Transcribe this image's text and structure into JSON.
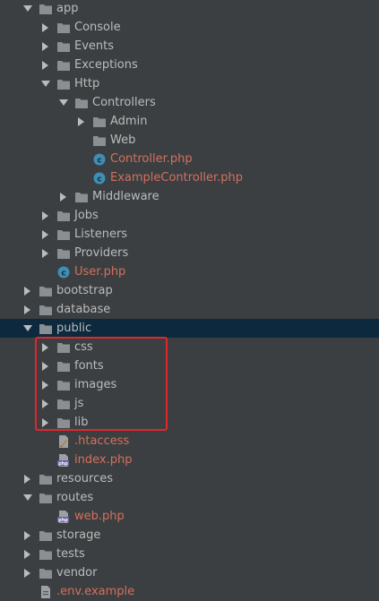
{
  "colors": {
    "background": "#3c3f41",
    "text": "#bbbbbb",
    "php_file_text": "#d2705e",
    "folder": "#8a8f93",
    "class_icon": "#3d8fb5",
    "selected_row": "#0d293e",
    "highlight_box": "#e2262a"
  },
  "tree": [
    {
      "label": "app",
      "depth": 1,
      "type": "folder",
      "expanded": true
    },
    {
      "label": "Console",
      "depth": 2,
      "type": "folder",
      "expanded": false
    },
    {
      "label": "Events",
      "depth": 2,
      "type": "folder",
      "expanded": false
    },
    {
      "label": "Exceptions",
      "depth": 2,
      "type": "folder",
      "expanded": false
    },
    {
      "label": "Http",
      "depth": 2,
      "type": "folder",
      "expanded": true
    },
    {
      "label": "Controllers",
      "depth": 3,
      "type": "folder",
      "expanded": true
    },
    {
      "label": "Admin",
      "depth": 4,
      "type": "folder",
      "expanded": false
    },
    {
      "label": "Web",
      "depth": 4,
      "type": "folder",
      "leaf": true
    },
    {
      "label": "Controller.php",
      "depth": 4,
      "type": "class-file",
      "php": true
    },
    {
      "label": "ExampleController.php",
      "depth": 4,
      "type": "class-file",
      "php": true
    },
    {
      "label": "Middleware",
      "depth": 3,
      "type": "folder",
      "expanded": false
    },
    {
      "label": "Jobs",
      "depth": 2,
      "type": "folder",
      "expanded": false
    },
    {
      "label": "Listeners",
      "depth": 2,
      "type": "folder",
      "expanded": false
    },
    {
      "label": "Providers",
      "depth": 2,
      "type": "folder",
      "expanded": false
    },
    {
      "label": "User.php",
      "depth": 2,
      "type": "class-file",
      "php": true
    },
    {
      "label": "bootstrap",
      "depth": 1,
      "type": "folder",
      "expanded": false
    },
    {
      "label": "database",
      "depth": 1,
      "type": "folder",
      "expanded": false
    },
    {
      "label": "public",
      "depth": 1,
      "type": "folder",
      "expanded": true,
      "selected": true
    },
    {
      "label": "css",
      "depth": 2,
      "type": "folder",
      "expanded": false
    },
    {
      "label": "fonts",
      "depth": 2,
      "type": "folder",
      "expanded": false
    },
    {
      "label": "images",
      "depth": 2,
      "type": "folder",
      "expanded": false
    },
    {
      "label": "js",
      "depth": 2,
      "type": "folder",
      "expanded": false
    },
    {
      "label": "lib",
      "depth": 2,
      "type": "folder",
      "expanded": false
    },
    {
      "label": ".htaccess",
      "depth": 2,
      "type": "htaccess-file",
      "php": true
    },
    {
      "label": "index.php",
      "depth": 2,
      "type": "php-file",
      "php": true
    },
    {
      "label": "resources",
      "depth": 1,
      "type": "folder",
      "expanded": false
    },
    {
      "label": "routes",
      "depth": 1,
      "type": "folder",
      "expanded": true
    },
    {
      "label": "web.php",
      "depth": 2,
      "type": "php-file",
      "php": true
    },
    {
      "label": "storage",
      "depth": 1,
      "type": "folder",
      "expanded": false
    },
    {
      "label": "tests",
      "depth": 1,
      "type": "folder",
      "expanded": false
    },
    {
      "label": "vendor",
      "depth": 1,
      "type": "folder",
      "expanded": false
    },
    {
      "label": ".env.example",
      "depth": 1,
      "type": "env-file",
      "php": true
    }
  ]
}
